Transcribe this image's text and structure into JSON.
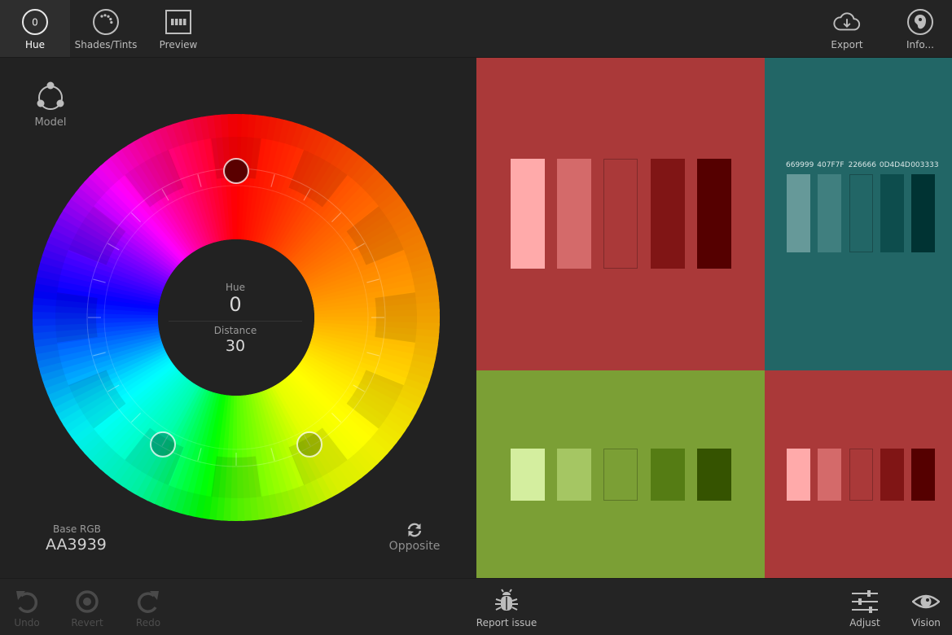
{
  "toolbar": {
    "hue": {
      "label": "Hue",
      "badge": "0"
    },
    "shades": {
      "label": "Shades/Tints"
    },
    "preview": {
      "label": "Preview"
    },
    "export": {
      "label": "Export"
    },
    "info": {
      "label": "Info..."
    }
  },
  "left": {
    "model_label": "Model",
    "center": {
      "hue_label": "Hue",
      "hue_value": "0",
      "distance_label": "Distance",
      "distance_value": "30"
    },
    "base_rgb_label": "Base RGB",
    "base_rgb_value": "AA3939",
    "opposite_label": "Opposite"
  },
  "markers": [
    {
      "hue": 0,
      "role": "base",
      "color": "#5a0000"
    },
    {
      "hue": 150,
      "role": "complement-1",
      "color": "#355000"
    },
    {
      "hue": 210,
      "role": "complement-2",
      "color": "#003333"
    }
  ],
  "palette": {
    "primary": [
      "#FFAAAA",
      "#D46A6A",
      "#AA3939",
      "#801515",
      "#550000"
    ],
    "secondary": [
      "#669999",
      "#407F7F",
      "#226666",
      "#0D4D4D",
      "#003333"
    ],
    "secondary_hex_labels": [
      "669999",
      "407F7F",
      "226666",
      "0D4D4D",
      "003333"
    ],
    "tertiary": [
      "#D4EE9F",
      "#A5C663",
      "#7B9F35",
      "#557C14",
      "#355300"
    ],
    "quad": [
      "#FFAAAA",
      "#D46A6A",
      "#AA3939",
      "#801515",
      "#550000"
    ]
  },
  "bottom": {
    "undo": "Undo",
    "revert": "Revert",
    "redo": "Redo",
    "report": "Report issue",
    "adjust": "Adjust",
    "vision": "Vision"
  },
  "colors": {
    "background": "#222222",
    "toolbar": "#242424",
    "tile_primary": "#AA3939",
    "tile_secondary": "#226666",
    "tile_tertiary": "#7B9F35",
    "tile_quad": "#AA3939"
  }
}
